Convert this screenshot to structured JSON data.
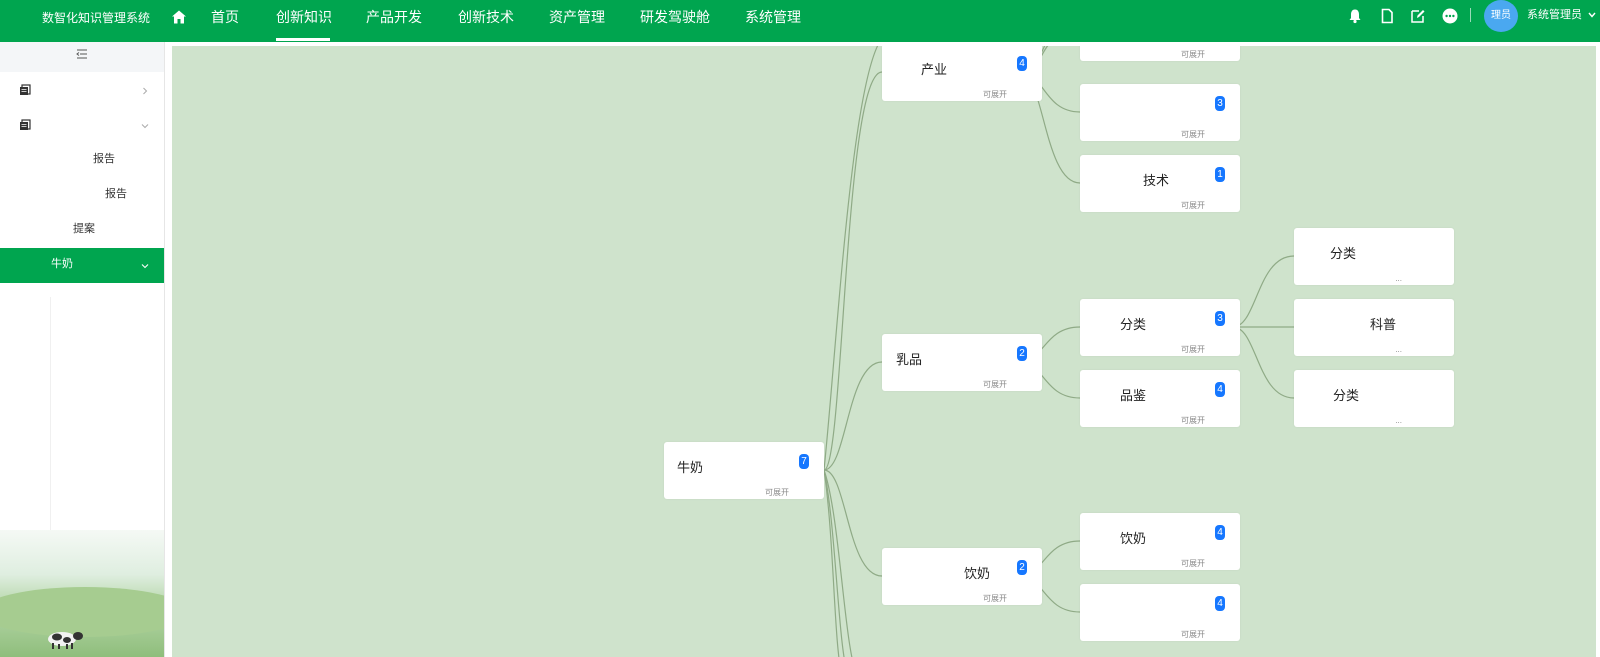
{
  "app": {
    "title": "数智化知识管理系统"
  },
  "nav": {
    "items": [
      {
        "label": "首页"
      },
      {
        "label": "创新知识"
      },
      {
        "label": "产品开发"
      },
      {
        "label": "创新技术"
      },
      {
        "label": "资产管理"
      },
      {
        "label": "研发驾驶舱"
      },
      {
        "label": "系统管理"
      }
    ],
    "active": "创新知识"
  },
  "user": {
    "avatar_text": "理员",
    "name": "系统管理员"
  },
  "icons": {
    "home": "home-icon",
    "bell": "bell-icon",
    "document": "document-icon",
    "edit": "edit-icon",
    "more": "more-icon",
    "collapse": "collapse-icon",
    "menu": "document-stack-icon"
  },
  "colors": {
    "brand": "#00a54f",
    "canvas": "#cfe3cc",
    "badge": "#1677ff",
    "link": "#8faa86",
    "avatar": "#4aa8f0"
  },
  "sidebar": {
    "items": [
      {
        "label": "",
        "expanded": false
      },
      {
        "label": "",
        "expanded": true
      },
      {
        "label": "报告"
      },
      {
        "label": "报告"
      },
      {
        "label": "提案"
      },
      {
        "label": "牛奶",
        "active": true
      }
    ]
  },
  "mindmap": {
    "expand_hint": "可展开",
    "collapsed_hint": "...",
    "nodes": [
      {
        "label": "牛奶",
        "count": "7"
      },
      {
        "label": "产业",
        "count": "4"
      },
      {
        "label": "乳品",
        "count": "2"
      },
      {
        "label": "饮奶",
        "count": "2"
      },
      {
        "label": "",
        "count": ""
      },
      {
        "label": "",
        "count": "3"
      },
      {
        "label": "技术",
        "count": "1"
      },
      {
        "label": "分类",
        "count": "3"
      },
      {
        "label": "品鉴",
        "count": "4"
      },
      {
        "label": "饮奶",
        "count": "4"
      },
      {
        "label": "",
        "count": "4"
      },
      {
        "label": "分类",
        "count": ""
      },
      {
        "label": "科普",
        "count": ""
      },
      {
        "label": "分类",
        "count": ""
      }
    ]
  }
}
